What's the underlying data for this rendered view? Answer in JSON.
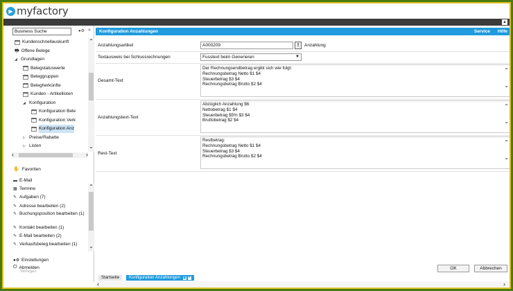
{
  "app": {
    "logo": "myfactory",
    "logo_icon": "play-icon"
  },
  "search": {
    "value": "Business Suche"
  },
  "tree": [
    {
      "label": "Kundenschnellauskunft",
      "icon": "form-icon",
      "indent": 0,
      "kind": "item"
    },
    {
      "label": "Offene Belege",
      "icon": "printer-icon",
      "indent": 0,
      "kind": "item"
    },
    {
      "label": "Grundlagen",
      "icon": "",
      "indent": 0,
      "kind": "open"
    },
    {
      "label": "Belegstatuswerte",
      "icon": "form-icon",
      "indent": 1,
      "kind": "item"
    },
    {
      "label": "Beleggruppen",
      "icon": "form-icon",
      "indent": 1,
      "kind": "item"
    },
    {
      "label": "Belegherkünfte",
      "icon": "form-icon",
      "indent": 1,
      "kind": "item"
    },
    {
      "label": "Kunden - Artikellisten",
      "icon": "form-icon",
      "indent": 1,
      "kind": "item"
    },
    {
      "label": "Konfiguration",
      "icon": "",
      "indent": 1,
      "kind": "open"
    },
    {
      "label": "Konfiguration Bele",
      "icon": "form-icon",
      "indent": 2,
      "kind": "item"
    },
    {
      "label": "Konfiguration Verk",
      "icon": "form-icon",
      "indent": 2,
      "kind": "item"
    },
    {
      "label": "Konfiguration Anz",
      "icon": "form-icon",
      "indent": 2,
      "kind": "item",
      "selected": true
    },
    {
      "label": "Preise/Rabatte",
      "icon": "",
      "indent": 1,
      "kind": "closed"
    },
    {
      "label": "Listen",
      "icon": "",
      "indent": 1,
      "kind": "closed"
    }
  ],
  "favorites": {
    "label": "Favoriten"
  },
  "fav_items": [
    {
      "label": "E-Mail",
      "icon": "mail-icon"
    },
    {
      "label": "Termine",
      "icon": "calendar-icon"
    },
    {
      "label": "Aufgaben (7)",
      "icon": "task-icon"
    },
    {
      "label": "Adresse bearbeiten (2)",
      "icon": "task-icon"
    },
    {
      "label": "Buchungsposition bearbeiten (1)",
      "icon": "task-icon"
    },
    {
      "label": "Kontakt bearbeiten (1)",
      "icon": "task-icon"
    },
    {
      "label": "E-Mail bearbeiten (2)",
      "icon": "task-icon"
    },
    {
      "label": "Verkaufsbeleg bearbeiten (1)",
      "icon": "task-icon"
    }
  ],
  "bottom": {
    "settings": "Einstellungen",
    "logout": "Abmelden",
    "sub": "Verlegen"
  },
  "main": {
    "title": "Konfiguration Anzahlungen",
    "service": "Service",
    "help": "Hilfe",
    "article_label": "Anzahlungsartikel",
    "article_value": "A000209",
    "article_btn": "!",
    "article_suffix": "Anzahlung",
    "textmode_label": "Textausweis bei Schlussrechnungen",
    "textmode_value": "Fusstext beim Generieren",
    "total_label": "Gesamt-Text",
    "total_text": [
      "Der Rechnungsendbetrag ergibt sich wie folgt:",
      "Rechnungsbetrag Netto $1 $4",
      "Steuerbetrag $3 $4",
      "Rechnungsbetrag Brutto $2 $4"
    ],
    "deposit_label": "Anzahlungstext-Text",
    "deposit_text": [
      "Abzüglich Anzahlung $6:",
      "Nettobetrag $1 $4",
      "Steuerbetrag $5% $3 $4",
      "Bruttobetrag $2 $4"
    ],
    "rest_label": "Rest-Text",
    "rest_text": [
      "Restbetrag:",
      "Rechnungsbetrag Netto $1 $4",
      "Steuerbetrag $3 $4",
      "Rechnungsbetrag Brutto $2 $4"
    ],
    "ok": "OK",
    "cancel": "Abbrechen"
  },
  "tabs": [
    {
      "label": "Startseite",
      "active": false
    },
    {
      "label": "Konfiguration Anzahlungen",
      "active": true
    }
  ]
}
